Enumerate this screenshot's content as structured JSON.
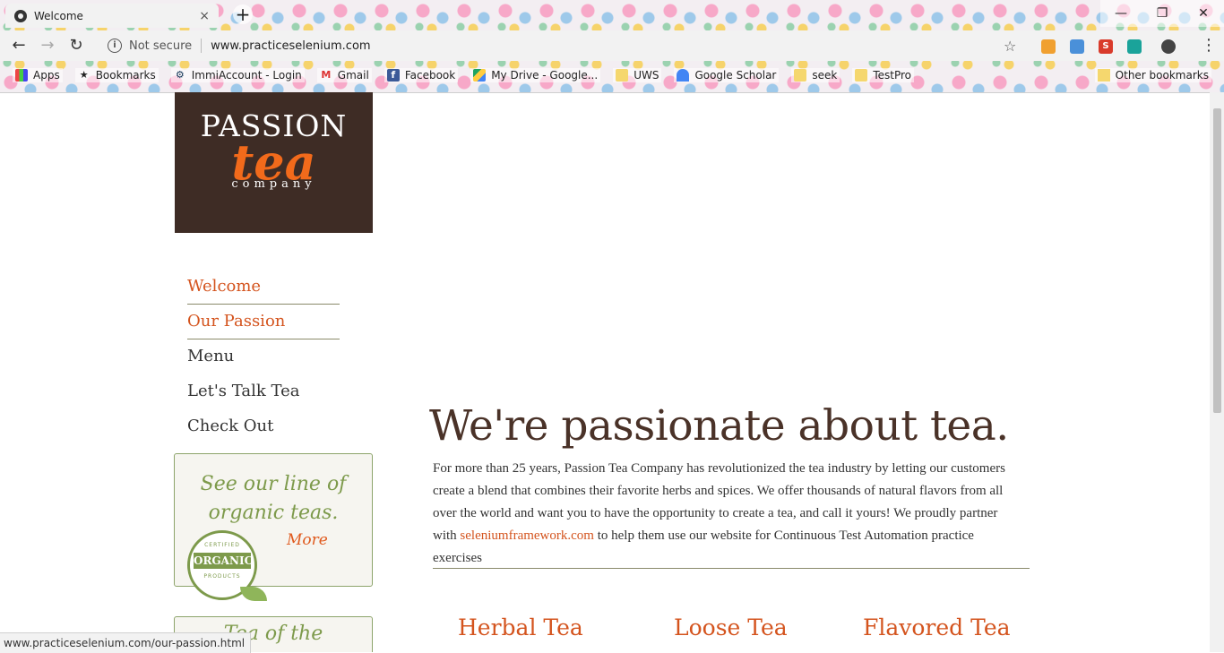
{
  "browser": {
    "tab_title": "Welcome",
    "tab_close": "×",
    "new_tab": "+",
    "security_label": "Not secure",
    "url": "www.practiceselenium.com",
    "bookmarks": [
      {
        "label": "Apps",
        "icon": "apps-grid-icon"
      },
      {
        "label": "Bookmarks",
        "icon": "star-icon"
      },
      {
        "label": "ImmiAccount - Login",
        "icon": "gear-icon"
      },
      {
        "label": "Gmail",
        "icon": "gmail-icon"
      },
      {
        "label": "Facebook",
        "icon": "facebook-icon"
      },
      {
        "label": "My Drive - Google...",
        "icon": "google-drive-icon"
      },
      {
        "label": "UWS",
        "icon": "folder-icon"
      },
      {
        "label": "Google Scholar",
        "icon": "scholar-icon"
      },
      {
        "label": "seek",
        "icon": "folder-icon"
      },
      {
        "label": "TestPro",
        "icon": "folder-icon"
      }
    ],
    "other_bookmarks": "Other bookmarks",
    "status_url": "www.practiceselenium.com/our-passion.html"
  },
  "logo": {
    "line1": "PASSION",
    "line2": "tea",
    "line3": "company"
  },
  "nav": {
    "items": [
      {
        "label": "Welcome",
        "active": true
      },
      {
        "label": "Our Passion",
        "active": true
      },
      {
        "label": "Menu",
        "active": false
      },
      {
        "label": "Let's Talk Tea",
        "active": false
      },
      {
        "label": "Check Out",
        "active": false
      }
    ]
  },
  "promo": {
    "line1": "See our line of",
    "line2": "organic teas.",
    "more": "More",
    "badge_top": "CERTIFIED",
    "badge_mid": "ORGANIC",
    "badge_bot": "PRODUCTS"
  },
  "promo2": {
    "text": "Tea of the"
  },
  "main": {
    "headline": "We're passionate about tea.",
    "intro_before": "For more than 25 years, Passion Tea Company has revolutionized the tea industry by letting our customers create a blend that combines their favorite herbs and spices. We offer thousands of natural flavors from all over the world and want you to have the opportunity to create a tea, and call it yours! We proudly partner with ",
    "intro_link": "seleniumframework.com",
    "intro_after": " to help them use our website for Continuous Test Automation practice exercises",
    "categories": [
      "Herbal Tea",
      "Loose Tea",
      "Flavored Tea"
    ]
  },
  "colors": {
    "accent": "#d4541e",
    "heading": "#4a3228",
    "logo_bg": "#3e2c25",
    "organic_green": "#7d9a4b"
  }
}
